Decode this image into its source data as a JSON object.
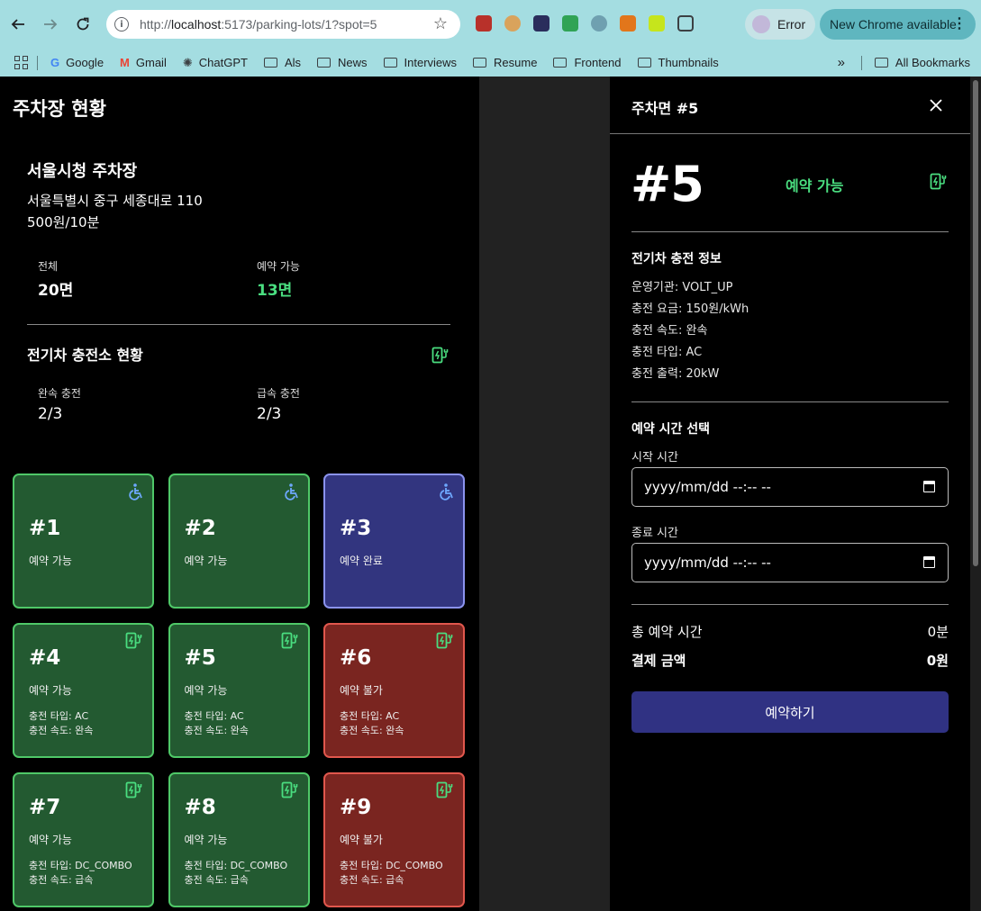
{
  "browser": {
    "url_prefix": "http://",
    "url_host": "localhost",
    "url_path": ":5173/parking-lots/1?spot=5",
    "error_label": "Error",
    "update_label": "New Chrome available",
    "bookmarks": [
      "Google",
      "Gmail",
      "ChatGPT",
      "Als",
      "News",
      "Interviews",
      "Resume",
      "Frontend",
      "Thumbnails"
    ],
    "all_bookmarks": "All Bookmarks"
  },
  "left": {
    "page_title": "주차장 현황",
    "lot_name": "서울시청 주차장",
    "lot_address": "서울특별시 중구 세종대로 110",
    "lot_fee": "500원/10분",
    "total_label": "전체",
    "total_value": "20면",
    "available_label": "예약 가능",
    "available_value": "13면",
    "ev_title": "전기차 충전소 현황",
    "slow_label": "완속 충전",
    "slow_value": "2/3",
    "fast_label": "급속 충전",
    "fast_value": "2/3"
  },
  "spots": [
    {
      "num": "#1",
      "status": "예약 가능",
      "state": "available",
      "icon": "wheelchair-icon"
    },
    {
      "num": "#2",
      "status": "예약 가능",
      "state": "available",
      "icon": "wheelchair-icon"
    },
    {
      "num": "#3",
      "status": "예약 완료",
      "state": "reserved",
      "icon": "wheelchair-icon"
    },
    {
      "num": "#4",
      "status": "예약 가능",
      "state": "available",
      "icon": "ev-charger-icon",
      "type": "충전 타입: AC",
      "speed": "충전 속도: 완속"
    },
    {
      "num": "#5",
      "status": "예약 가능",
      "state": "available",
      "icon": "ev-charger-icon",
      "type": "충전 타입: AC",
      "speed": "충전 속도: 완속"
    },
    {
      "num": "#6",
      "status": "예약 불가",
      "state": "unavailable",
      "icon": "ev-charger-icon",
      "type": "충전 타입: AC",
      "speed": "충전 속도: 완속"
    },
    {
      "num": "#7",
      "status": "예약 가능",
      "state": "available",
      "icon": "ev-charger-icon",
      "type": "충전 타입: DC_COMBO",
      "speed": "충전 속도: 급속"
    },
    {
      "num": "#8",
      "status": "예약 가능",
      "state": "available",
      "icon": "ev-charger-icon",
      "type": "충전 타입: DC_COMBO",
      "speed": "충전 속도: 급속"
    },
    {
      "num": "#9",
      "status": "예약 불가",
      "state": "unavailable",
      "icon": "ev-charger-icon",
      "type": "충전 타입: DC_COMBO",
      "speed": "충전 속도: 급속"
    }
  ],
  "drawer": {
    "title": "주차면 #5",
    "close_icon": "close-icon",
    "big_num": "#5",
    "status": "예약 가능",
    "ev_section_title": "전기차 충전 정보",
    "operator": "운영기관: VOLT_UP",
    "rate": "충전 요금: 150원/kWh",
    "speed": "충전 속도: 완속",
    "type": "충전 타입: AC",
    "output": "충전 출력: 20kW",
    "time_section_title": "예약 시간 선택",
    "start_label": "시작 시간",
    "start_value": "yyyy/mm/dd --:-- --",
    "end_label": "종료 시간",
    "end_value": "yyyy/mm/dd --:-- --",
    "total_time_label": "총 예약 시간",
    "total_time_value": "0분",
    "payment_label": "결제 금액",
    "payment_value": "0원",
    "reserve_button": "예약하기"
  },
  "colors": {
    "available_bg": "#235a31",
    "available_border": "#4fc868",
    "reserved_bg": "#32357f",
    "reserved_border": "#8b93ee",
    "unavailable_bg": "#7a2520",
    "unavailable_border": "#e1574d",
    "accent_green": "#4ade80",
    "button_blue": "#303283"
  }
}
